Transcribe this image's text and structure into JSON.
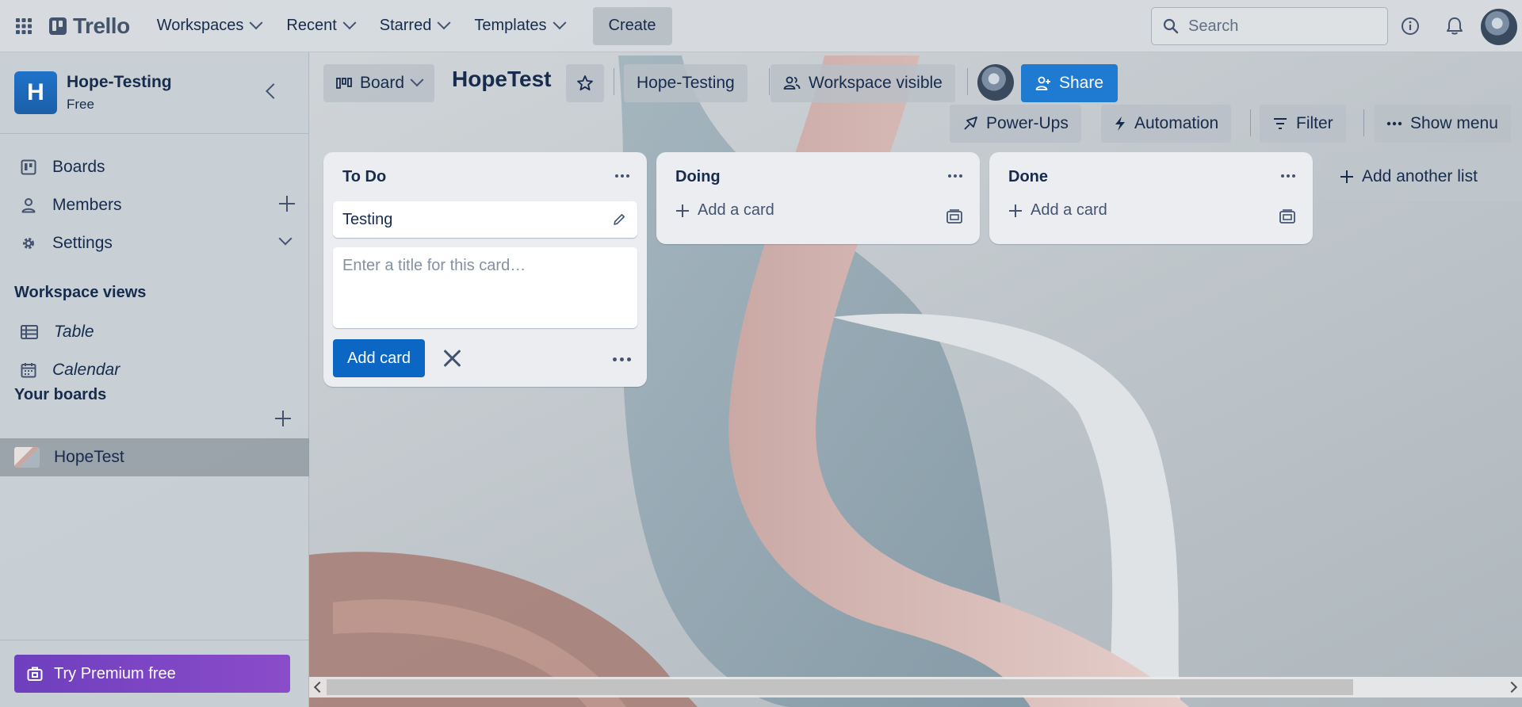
{
  "topbar": {
    "app_name": "Trello",
    "nav": [
      "Workspaces",
      "Recent",
      "Starred",
      "Templates"
    ],
    "create_label": "Create",
    "search_placeholder": "Search"
  },
  "sidebar": {
    "workspace_initial": "H",
    "workspace_name": "Hope-Testing",
    "workspace_plan": "Free",
    "items": [
      {
        "label": "Boards",
        "icon": "board-icon"
      },
      {
        "label": "Members",
        "icon": "person-icon"
      },
      {
        "label": "Settings",
        "icon": "gear-icon"
      }
    ],
    "workspace_views_title": "Workspace views",
    "views": [
      {
        "label": "Table",
        "icon": "table-icon"
      },
      {
        "label": "Calendar",
        "icon": "calendar-icon"
      }
    ],
    "your_boards_title": "Your boards",
    "boards": [
      {
        "label": "HopeTest",
        "active": true
      }
    ],
    "premium_label": "Try Premium free"
  },
  "board": {
    "view_label": "Board",
    "title": "HopeTest",
    "workspace_label": "Hope-Testing",
    "visibility_label": "Workspace visible",
    "share_label": "Share",
    "powerups_label": "Power-Ups",
    "automation_label": "Automation",
    "filter_label": "Filter",
    "show_menu_label": "Show menu"
  },
  "lists": [
    {
      "title": "To Do",
      "cards": [
        "Testing"
      ],
      "composer_placeholder": "Enter a title for this card…",
      "add_card_button": "Add card"
    },
    {
      "title": "Doing",
      "add_card_label": "Add a card"
    },
    {
      "title": "Done",
      "add_card_label": "Add a card"
    }
  ],
  "add_list_label": "Add another list",
  "colors": {
    "primary": "#0c66c4",
    "share": "#1f7ad1",
    "premium": "#7a45c4",
    "text": "#172b4d"
  }
}
